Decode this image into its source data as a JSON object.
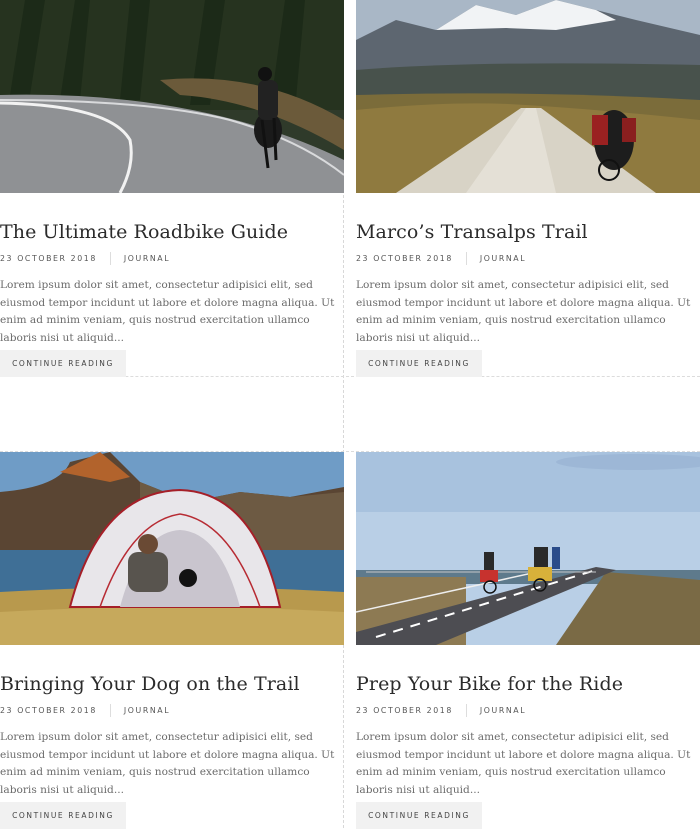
{
  "posts": [
    {
      "title": "The Ultimate Roadbike Guide",
      "date": "23 OCTOBER 2018",
      "category": "JOURNAL",
      "excerpt": "Lorem ipsum dolor sit amet, consectetur adipisici elit, sed eiusmod tempor incidunt ut labore et dolore magna aliqua. Ut enim ad minim veniam, quis nostrud exercitation ullamco laboris nisi ut aliquid...",
      "cta": "CONTINUE READING"
    },
    {
      "title": "Marco’s Transalps Trail",
      "date": "23 OCTOBER 2018",
      "category": "JOURNAL",
      "excerpt": "Lorem ipsum dolor sit amet, consectetur adipisici elit, sed eiusmod tempor incidunt ut labore et dolore magna aliqua. Ut enim ad minim veniam, quis nostrud exercitation ullamco laboris nisi ut aliquid...",
      "cta": "CONTINUE READING"
    },
    {
      "title": "Bringing Your Dog on the Trail",
      "date": "23 OCTOBER 2018",
      "category": "JOURNAL",
      "excerpt": "Lorem ipsum dolor sit amet, consectetur adipisici elit, sed eiusmod tempor incidunt ut labore et dolore magna aliqua. Ut enim ad minim veniam, quis nostrud exercitation ullamco laboris nisi ut aliquid...",
      "cta": "CONTINUE READING"
    },
    {
      "title": "Prep Your Bike for the Ride",
      "date": "23 OCTOBER 2018",
      "category": "JOURNAL",
      "excerpt": "Lorem ipsum dolor sit amet, consectetur adipisici elit, sed eiusmod tempor incidunt ut labore et dolore magna aliqua. Ut enim ad minim veniam, quis nostrud exercitation ullamco laboris nisi ut aliquid...",
      "cta": "CONTINUE READING"
    }
  ]
}
